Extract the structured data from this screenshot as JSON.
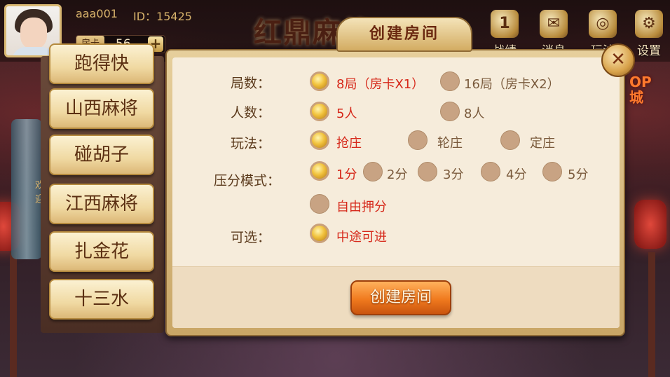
{
  "user": {
    "name": "aaa001",
    "id_text": "ID：15425",
    "card_label": "房卡",
    "card_count": "56",
    "add_symbol": "+"
  },
  "brand": "红鼎麻将",
  "top_menu": [
    {
      "label": "战绩",
      "icon": "record-icon",
      "glyph": "1"
    },
    {
      "label": "消息",
      "icon": "message-icon",
      "glyph": "✉"
    },
    {
      "label": "玩法",
      "icon": "rules-icon",
      "glyph": "◎"
    },
    {
      "label": "设置",
      "icon": "gear-icon",
      "glyph": "⚙"
    }
  ],
  "shop_text": "OP\n城",
  "scroll_text": "欢迎",
  "games": [
    "跑得快",
    "山西麻将",
    "碰胡子",
    "江西麻将",
    "扎金花",
    "十三水"
  ],
  "dialog": {
    "title": "创建房间",
    "close_symbol": "✕",
    "rounds_label": "局数：",
    "rounds_options": [
      {
        "label": "8局（房卡X1）",
        "selected": true
      },
      {
        "label": "16局（房卡X2）",
        "selected": false
      }
    ],
    "players_label": "人数：",
    "players_options": [
      {
        "label": "5人",
        "selected": true
      },
      {
        "label": "8人",
        "selected": false
      }
    ],
    "play_label": "玩法：",
    "play_options": [
      {
        "label": "抢庄",
        "selected": true
      },
      {
        "label": "轮庄",
        "selected": false
      },
      {
        "label": "定庄",
        "selected": false
      }
    ],
    "bet_label": "压分模式：",
    "bet_options": [
      {
        "label": "1分",
        "selected": true
      },
      {
        "label": "2分",
        "selected": false
      },
      {
        "label": "3分",
        "selected": false
      },
      {
        "label": "4分",
        "selected": false
      },
      {
        "label": "5分",
        "selected": false
      },
      {
        "label": "自由押分",
        "selected": false
      }
    ],
    "optional_label": "可选：",
    "optional_options": [
      {
        "label": "中途可进",
        "selected": true
      }
    ],
    "create_button": "创建房间"
  }
}
